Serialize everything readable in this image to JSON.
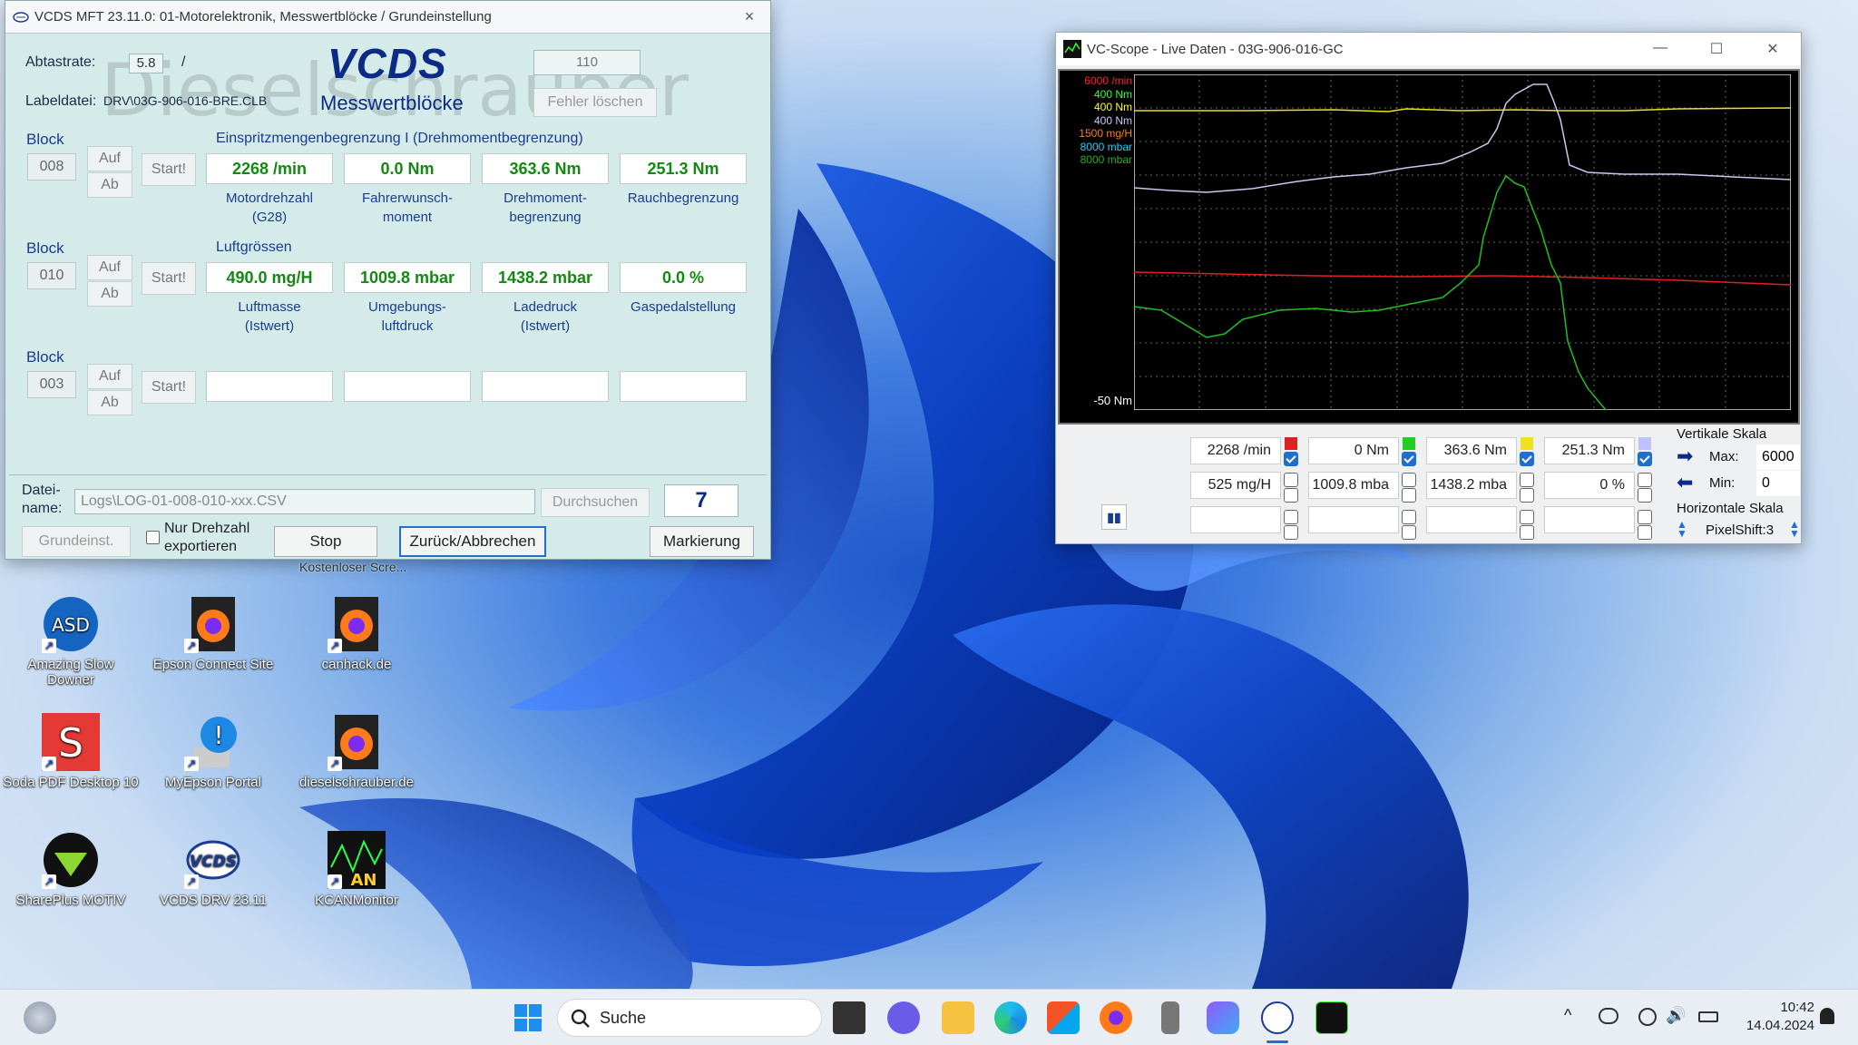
{
  "vcds": {
    "title": "VCDS MFT 23.11.0: 01-Motorelektronik,  Messwertblöcke / Grundeinstellung",
    "close": "×",
    "abtastrate_label": "Abtastrate:",
    "abtastrate_value": "5.8",
    "slash": "/",
    "group_value": "110",
    "logo": "VCDS",
    "subtitle": "Messwertblöcke",
    "fehler_button": "Fehler löschen",
    "labeldatei_label": "Labeldatei:",
    "labeldatei_value": "DRV\\03G-906-016-BRE.CLB",
    "watermark": "Dieselschrauber",
    "blocks": [
      {
        "label": "Block",
        "number": "008",
        "auf": "Auf",
        "ab": "Ab",
        "start": "Start!",
        "heading": "Einspritzmengenbegrenzung I (Drehmomentbegrenzung)",
        "values": [
          "2268 /min",
          "0.0 Nm",
          "363.6 Nm",
          "251.3 Nm"
        ],
        "labels": [
          "Motordrehzahl\n(G28)",
          "Fahrerwunsch-\nmoment",
          "Drehmoment-\nbegrenzung",
          "Rauchbegrenzung"
        ]
      },
      {
        "label": "Block",
        "number": "010",
        "auf": "Auf",
        "ab": "Ab",
        "start": "Start!",
        "heading": "Luftgrössen",
        "values": [
          "490.0 mg/H",
          "1009.8 mbar",
          "1438.2 mbar",
          "0.0 %"
        ],
        "labels": [
          "Luftmasse\n(Istwert)",
          "Umgebungs-\nluftdruck",
          "Ladedruck\n(Istwert)",
          "Gaspedalstellung"
        ]
      },
      {
        "label": "Block",
        "number": "003",
        "auf": "Auf",
        "ab": "Ab",
        "start": "Start!",
        "heading": "",
        "values": [
          "",
          "",
          "",
          ""
        ],
        "labels": [
          "",
          "",
          "",
          ""
        ]
      }
    ],
    "datei_label": "Datei-\nname:",
    "datei_value": "Logs\\LOG-01-008-010-xxx.CSV",
    "durchsuchen": "Durchsuchen",
    "counter": "7",
    "grundeinst": "Grundeinst.",
    "nur_drehzahl": "Nur Drehzahl\nexportieren",
    "stop": "Stop",
    "zurueck": "Zurück/Abbrechen",
    "markierung": "Markierung",
    "overlay_text": "Kostenloser Scre..."
  },
  "scope": {
    "title": "VC-Scope  -  Live Daten  -  03G-906-016-GC",
    "min_btn": "—",
    "max_btn": "☐",
    "close_btn": "✕",
    "scale_labels": [
      {
        "text": "6000 /min",
        "color": "#ff2020"
      },
      {
        "text": "400 Nm",
        "color": "#30ff30"
      },
      {
        "text": "400 Nm",
        "color": "#ffff30"
      },
      {
        "text": "400 Nm",
        "color": "#c8c8ff"
      },
      {
        "text": "1500 mg/H",
        "color": "#ff7a1a"
      },
      {
        "text": "8000 mbar",
        "color": "#1ad0ff"
      },
      {
        "text": "8000 mbar",
        "color": "#20b020"
      }
    ],
    "min_label": "-50 Nm",
    "row1": [
      "2268 /min",
      "0 Nm",
      "363.6 Nm",
      "251.3 Nm"
    ],
    "row2": [
      "525 mg/H",
      "1009.8 mba",
      "1438.2 mba",
      "0 %"
    ],
    "row3": [
      "",
      "",
      "",
      ""
    ],
    "swatches": [
      "#e02020",
      "#20d020",
      "#f0e020",
      "#c0c0ff"
    ],
    "vertikale_skala": "Vertikale Skala",
    "max_label": "Max:",
    "max_value": "6000",
    "min_label2": "Min:",
    "min_value": "0",
    "horizontale_skala": "Horizontale Skala",
    "pixelshift": "PixelShift:3"
  },
  "desktop_icons": [
    {
      "label": "Amazing Slow\nDowner",
      "icon": "asd-icon"
    },
    {
      "label": "Epson Connect Site",
      "icon": "firefox-icon"
    },
    {
      "label": "canhack.de",
      "icon": "firefox-icon"
    },
    {
      "label": "Soda PDF Desktop 10",
      "icon": "soda-pdf-icon"
    },
    {
      "label": "MyEpson Portal",
      "icon": "info-icon"
    },
    {
      "label": "dieselschrauber.de",
      "icon": "firefox-icon"
    },
    {
      "label": "SharePlus MOTIV",
      "icon": "shareplus-icon"
    },
    {
      "label": "VCDS DRV 23.11",
      "icon": "vcds-icon"
    },
    {
      "label": "KCANMonitor",
      "icon": "kcan-icon"
    }
  ],
  "taskbar": {
    "search_placeholder": "Suche",
    "time": "10:42",
    "date": "14.04.2024"
  }
}
